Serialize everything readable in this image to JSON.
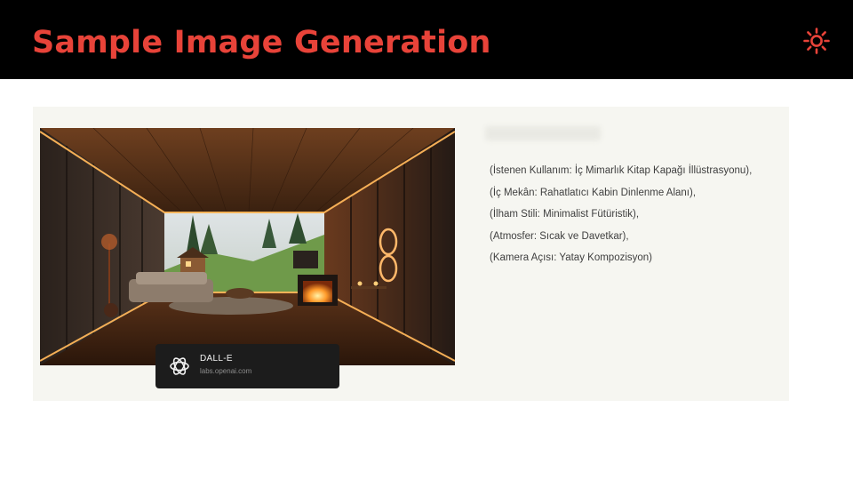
{
  "header": {
    "title": "Sample Image Generation",
    "title_color": "#e84339",
    "background": "#000000",
    "theme_icon": "sun-icon"
  },
  "image_card": {
    "app_name": "DALL-E",
    "app_url": "labs.openai.com",
    "logo_icon": "openai-logo-icon"
  },
  "prompt": {
    "lines": [
      "(İstenen Kullanım: İç Mimarlık Kitap Kapağı İllüstrasyonu),",
      "(İç Mekân: Rahatlatıcı Kabin Dinlenme Alanı),",
      "(İlham Stili: Minimalist Fütüristik),",
      "(Atmosfer: Sıcak ve Davetkar),",
      "(Kamera Açısı: Yatay Kompozisyon)"
    ]
  }
}
